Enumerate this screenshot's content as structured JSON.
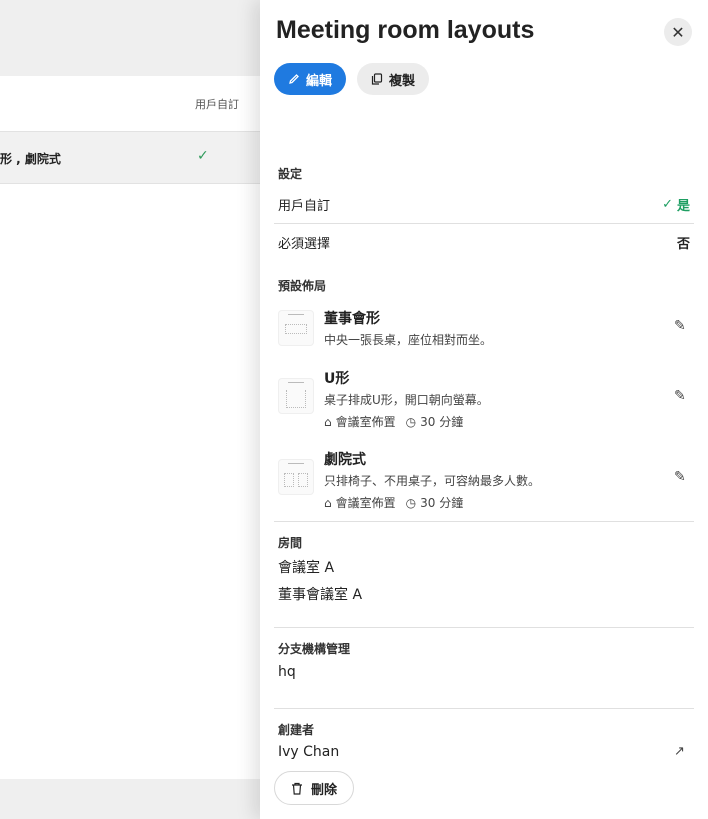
{
  "background": {
    "column_header": "用戶自訂",
    "row_text": "形 , 劇院式"
  },
  "drawer": {
    "title": "Meeting room layouts",
    "edit_label": "編輯",
    "copy_label": "複製",
    "settings_label": "設定",
    "settings": [
      {
        "label": "用戶自訂",
        "value": "是"
      },
      {
        "label": "必須選擇",
        "value": "否"
      }
    ],
    "default_layout_label": "預設佈局",
    "layouts": [
      {
        "name": "董事會形",
        "desc": "中央一張長桌，座位相對而坐。"
      },
      {
        "name": "U形",
        "desc": "桌子排成U形，開口朝向螢幕。",
        "setup": "會議室佈置",
        "duration": "30 分鐘"
      },
      {
        "name": "劇院式",
        "desc": "只排椅子、不用桌子，可容納最多人數。",
        "setup": "會議室佈置",
        "duration": "30 分鐘"
      }
    ],
    "rooms_label": "房間",
    "rooms": [
      "會議室 A",
      "董事會議室 A"
    ],
    "branch_label": "分支機構管理",
    "branch_value": "hq",
    "creator_label": "創建者",
    "creator_value": "Ivy Chan",
    "delete_label": "刪除"
  },
  "icons": {
    "close": "close-icon",
    "edit": "pencil-icon",
    "copy": "copy-icon",
    "delete": "trash-icon",
    "check": "check-icon",
    "setup": "bell-icon",
    "clock": "clock-icon",
    "external": "external-link-icon"
  },
  "colors": {
    "primary": "#1f7ae0",
    "success": "#1e9e62"
  }
}
